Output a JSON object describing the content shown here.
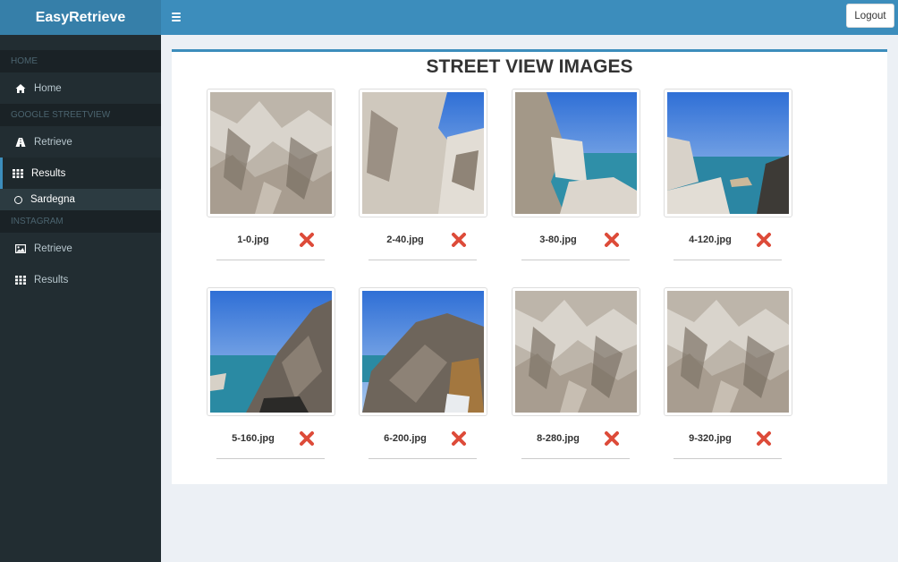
{
  "app": {
    "title": "EasyRetrieve"
  },
  "header": {
    "logout_label": "Logout"
  },
  "sidebar": {
    "home_header": "HOME",
    "home_label": "Home",
    "gsv_header": "GOOGLE STREETVIEW",
    "gsv_retrieve_label": "Retrieve",
    "gsv_results_label": "Results",
    "gsv_sub_label": "Sardegna",
    "insta_header": "INSTAGRAM",
    "insta_retrieve_label": "Retrieve",
    "insta_results_label": "Results"
  },
  "main": {
    "title": "STREET VIEW IMAGES",
    "images": [
      {
        "name": "1-0.jpg",
        "scene": "rock"
      },
      {
        "name": "2-40.jpg",
        "scene": "rock-sky"
      },
      {
        "name": "3-80.jpg",
        "scene": "rock-sea"
      },
      {
        "name": "4-120.jpg",
        "scene": "sea-rock"
      },
      {
        "name": "5-160.jpg",
        "scene": "sea-boulder"
      },
      {
        "name": "6-200.jpg",
        "scene": "boulder"
      },
      {
        "name": "8-280.jpg",
        "scene": "rock"
      },
      {
        "name": "9-320.jpg",
        "scene": "rock"
      }
    ]
  },
  "colors": {
    "sidebar": "#222d32",
    "header": "#3c8dbc",
    "logo": "#367fa9",
    "delete": "#dd4b39"
  },
  "icons": {
    "delete": "close-icon",
    "home": "home-icon",
    "retrieve": "road-icon",
    "results": "grid-icon",
    "instagram_retrieve": "image-icon"
  }
}
